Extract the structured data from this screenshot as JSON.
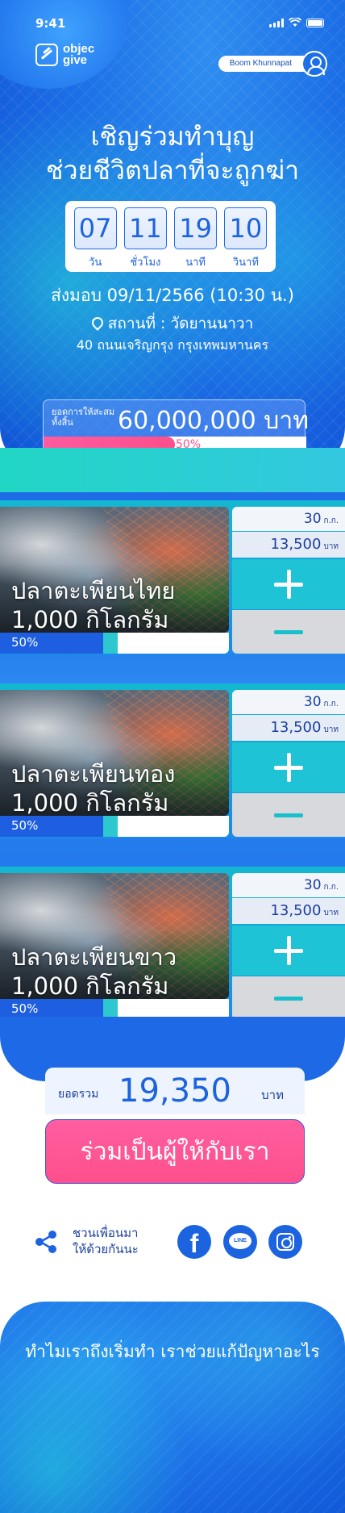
{
  "status_bar": {
    "time": "9:41"
  },
  "brand": {
    "line1": "objec",
    "line2": "give"
  },
  "user": {
    "name": "Boom Khunnapat"
  },
  "hero": {
    "title_line1": "เชิญร่วมทำบุญ",
    "title_line2": "ช่วยชีวิตปลาที่จะถูกฆ่า"
  },
  "countdown": [
    {
      "value": "07",
      "unit": "วัน"
    },
    {
      "value": "11",
      "unit": "ชั่วโมง"
    },
    {
      "value": "19",
      "unit": "นาที"
    },
    {
      "value": "10",
      "unit": "วินาที"
    }
  ],
  "event": {
    "delivery": "ส่งมอบ 09/11/2566 (10:30 น.)",
    "venue": "สถานที่ : วัดยานนาวา",
    "address": "40 ถนนเจริญกรุง กรุงเทพมหานคร"
  },
  "total_donation": {
    "label": "ยอดการให้สะสมทั้งสิ้น",
    "value": "60,000,000 บาท",
    "percent_text": "50%",
    "progress": 0.5
  },
  "products": [
    {
      "name_line1": "ปลาตะเพียนไทย",
      "name_line2": "1,000 กิโลกรัม",
      "percent_text": "50%",
      "progress": 0.5,
      "qty": "30",
      "qty_unit": "ก.ก.",
      "price": "13,500",
      "price_unit": "บาท"
    },
    {
      "name_line1": "ปลาตะเพียนทอง",
      "name_line2": "1,000 กิโลกรัม",
      "percent_text": "50%",
      "progress": 0.5,
      "qty": "30",
      "qty_unit": "ก.ก.",
      "price": "13,500",
      "price_unit": "บาท"
    },
    {
      "name_line1": "ปลาตะเพียนขาว",
      "name_line2": "1,000 กิโลกรัม",
      "percent_text": "50%",
      "progress": 0.5,
      "qty": "30",
      "qty_unit": "ก.ก.",
      "price": "13,500",
      "price_unit": "บาท"
    }
  ],
  "summary": {
    "label": "ยอดรวม",
    "value": "19,350",
    "unit": "บาท"
  },
  "cta": {
    "label": "ร่วมเป็นผู้ให้กับเรา"
  },
  "share": {
    "line1": "ชวนเพื่อนมา",
    "line2": "ให้ด้วยกันนะ",
    "icons": [
      "share-icon",
      "facebook-icon",
      "line-icon",
      "instagram-icon"
    ],
    "line_text": "LINE",
    "fb_text": "f"
  },
  "bottom": {
    "headline": "ทำไมเราถึงเริ่มทำ เราช่วยแก้ปัญหาอะไร"
  },
  "colors": {
    "brand_blue": "#1c63e0",
    "teal": "#1fc3d6",
    "pink": "#ff4f8c"
  }
}
